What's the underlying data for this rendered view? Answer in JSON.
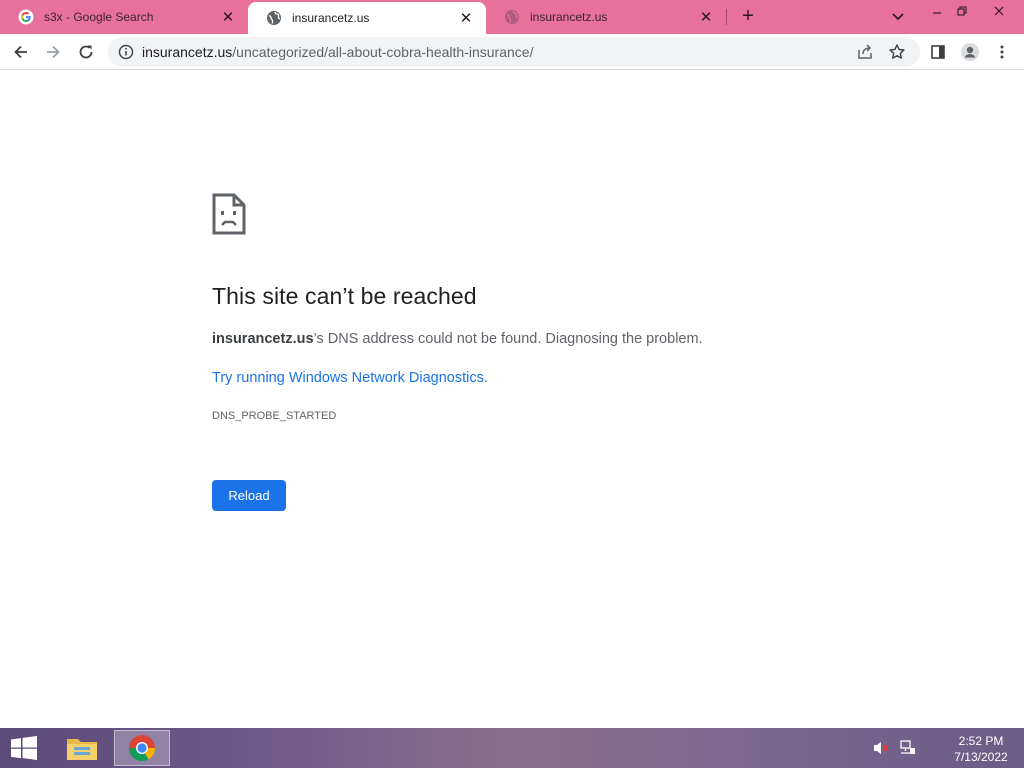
{
  "tabs": [
    {
      "title": "s3x - Google Search",
      "favicon": "google-icon",
      "active": false
    },
    {
      "title": "insurancetz.us",
      "favicon": "globe-icon",
      "active": true
    },
    {
      "title": "insurancetz.us",
      "favicon": "globe-icon",
      "active": false
    }
  ],
  "new_tab_label": "+",
  "address_bar": {
    "host": "insurancetz.us",
    "path": "/uncategorized/all-about-cobra-health-insurance/"
  },
  "error_page": {
    "title": "This site can’t be reached",
    "description_host": "insurancetz.us",
    "description_rest": "’s DNS address could not be found. Diagnosing the problem.",
    "link_text": "Try running Windows Network Diagnostics",
    "link_suffix": ".",
    "error_code": "DNS_PROBE_STARTED",
    "reload_label": "Reload"
  },
  "taskbar": {
    "time": "2:52 PM",
    "date": "7/13/2022"
  },
  "colors": {
    "tab_strip": "#e8719b",
    "accent_blue": "#1a73e8",
    "page_bg": "#ffffff"
  }
}
